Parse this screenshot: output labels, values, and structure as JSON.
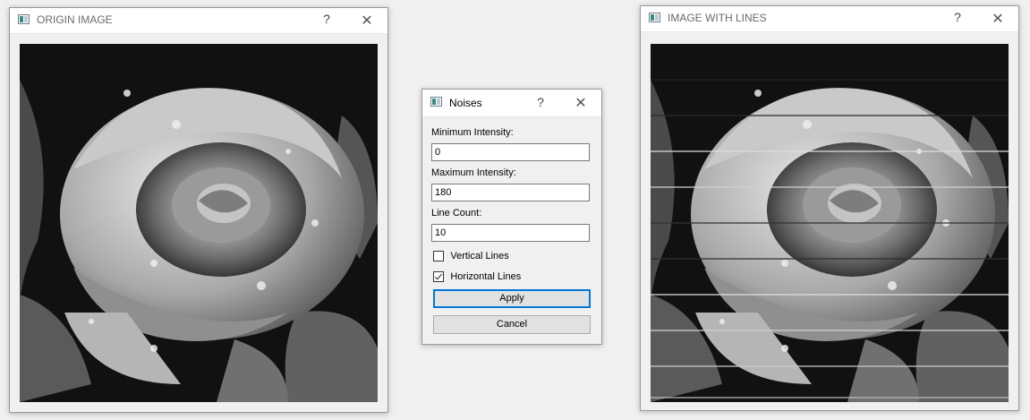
{
  "origin_window": {
    "title": "ORIGIN IMAGE",
    "help_label": "?",
    "close_label": "✕",
    "icon": "window-app-icon"
  },
  "lines_window": {
    "title": "IMAGE WITH LINES",
    "help_label": "?",
    "close_label": "✕",
    "icon": "window-app-icon"
  },
  "noises_dialog": {
    "title": "Noises",
    "help_label": "?",
    "close_label": "✕",
    "min_intensity_label": "Minimum Intensity:",
    "min_intensity_value": "0",
    "max_intensity_label": "Maximum Intensity:",
    "max_intensity_value": "180",
    "line_count_label": "Line Count:",
    "line_count_value": "10",
    "vertical_lines_label": "Vertical Lines",
    "vertical_lines_checked": false,
    "horizontal_lines_label": "Horizontal Lines",
    "horizontal_lines_checked": true,
    "apply_label": "Apply",
    "cancel_label": "Cancel"
  }
}
